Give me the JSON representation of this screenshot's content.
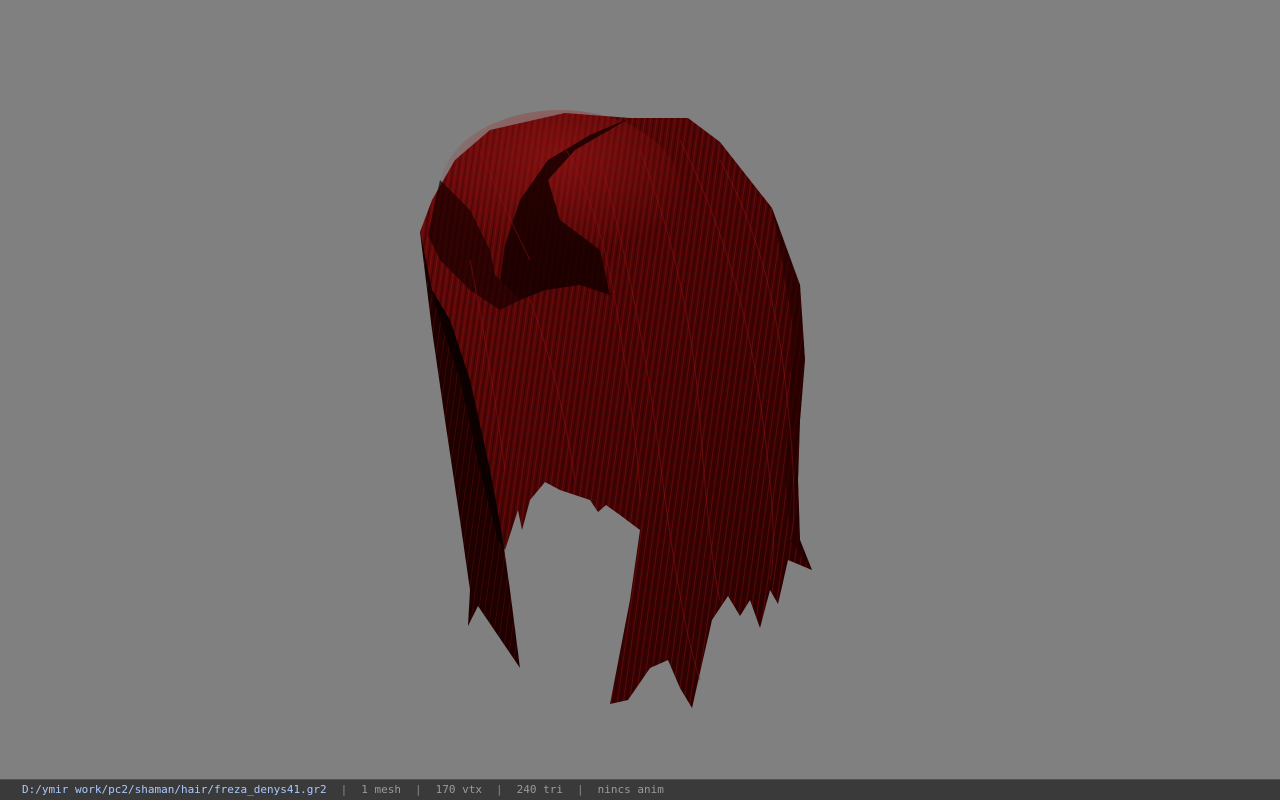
{
  "viewport": {
    "background_color": "#808080",
    "model": {
      "description": "hair-mesh",
      "base_color": "#5a0606",
      "highlight_color": "#a01818",
      "shadow_color": "#1a0000"
    }
  },
  "status_bar": {
    "file_path": "D:/ymir work/pc2/shaman/hair/freza_denys41.gr2",
    "separator": "|",
    "mesh_count": "1 mesh",
    "vertex_count": "170 vtx",
    "triangle_count": "240 tri",
    "animation": "nincs anim"
  }
}
